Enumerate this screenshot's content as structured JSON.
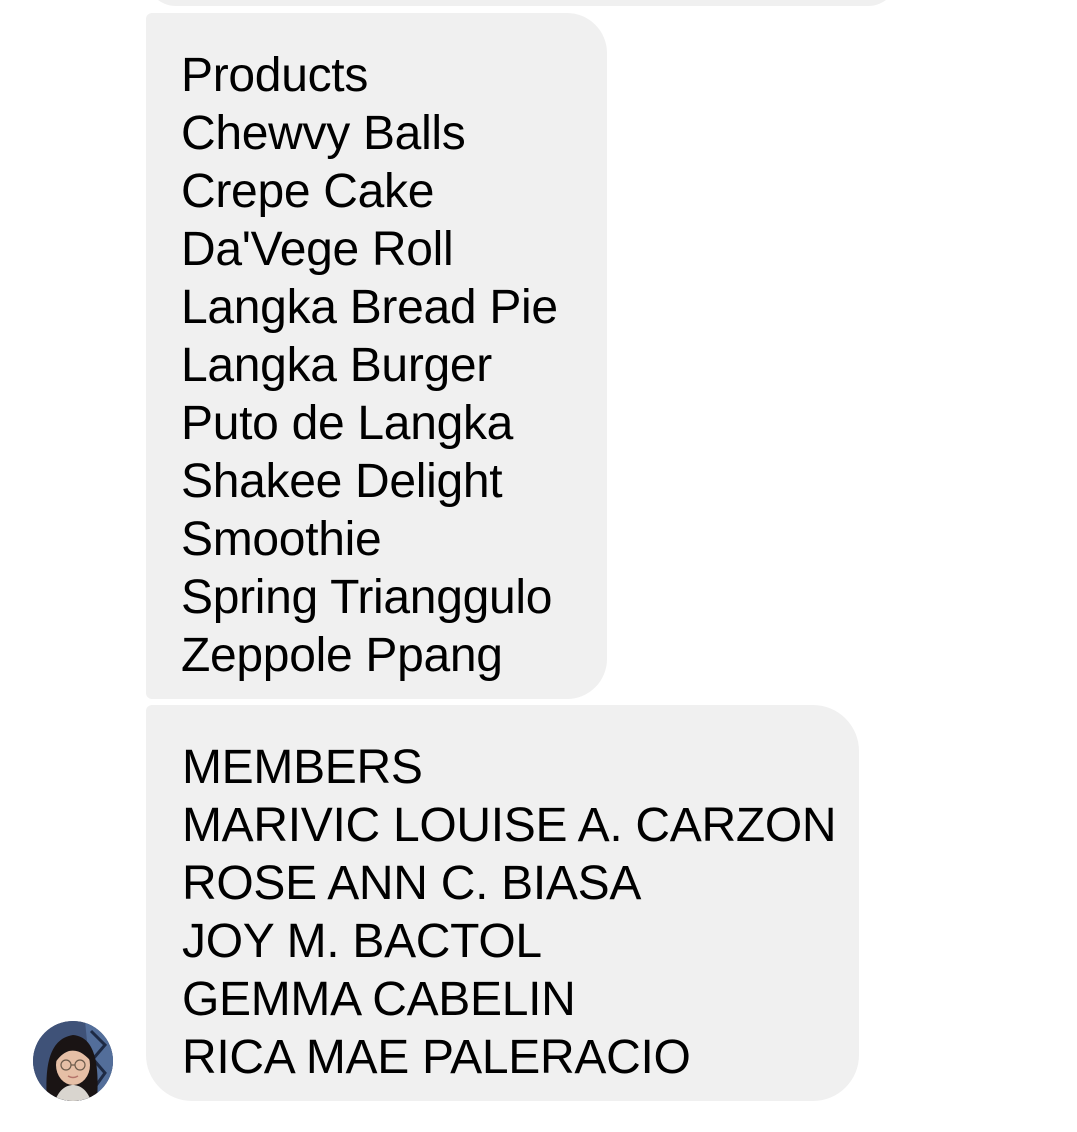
{
  "conversation": {
    "products_message": {
      "heading": "Products",
      "items": [
        "Chewvy Balls",
        "Crepe Cake",
        "Da'Vege Roll",
        "Langka Bread Pie",
        "Langka Burger",
        "Puto de Langka",
        "Shakee Delight",
        "Smoothie",
        "Spring Trianggulo",
        "Zeppole Ppang"
      ]
    },
    "members_message": {
      "heading": "MEMBERS",
      "items": [
        "MARIVIC LOUISE A. CARZON",
        "ROSE ANN C. BIASA",
        "JOY M. BACTOL",
        "GEMMA CABELIN",
        "RICA MAE PALERACIO"
      ]
    },
    "avatar_icon": "user-avatar-photo",
    "colors": {
      "bubble_bg": "#f0f0f0",
      "text": "#000000",
      "background": "#ffffff"
    }
  }
}
